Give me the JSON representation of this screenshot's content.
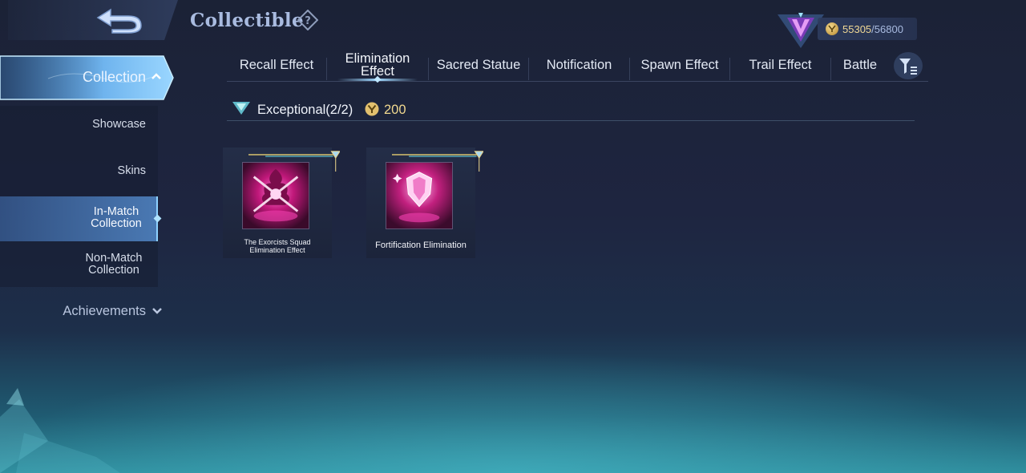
{
  "header": {
    "title": "Collectible",
    "help_icon": "question-mark-icon",
    "back_icon": "back-arrow-icon"
  },
  "currency": {
    "current": "55305",
    "max": "/56800",
    "icon": "collection-point-coin-icon",
    "rank_icon": "purple-rank-badge-icon"
  },
  "tabs": [
    {
      "label": "Recall Effect",
      "active": false
    },
    {
      "label": "Elimination Effect",
      "active": true
    },
    {
      "label": "Sacred Statue",
      "active": false
    },
    {
      "label": "Notification",
      "active": false
    },
    {
      "label": "Spawn Effect",
      "active": false
    },
    {
      "label": "Trail Effect",
      "active": false
    },
    {
      "label": "Battle",
      "active": false
    }
  ],
  "filter_icon": "filter-funnel-icon",
  "sidebar": {
    "collection_label": "Collection",
    "items": [
      {
        "label": "Showcase",
        "active": false
      },
      {
        "label": "Skins",
        "active": false
      },
      {
        "label": "In-Match Collection",
        "active": true
      },
      {
        "label": "Non-Match Collection",
        "active": false
      }
    ],
    "achievements_label": "Achievements"
  },
  "section": {
    "title": "Exceptional(2/2)",
    "cost": "200",
    "icon": "exceptional-gem-icon"
  },
  "cards": [
    {
      "name": "The Exorcists Squad Elimination Effect",
      "icon": "crossed-blades-elimination-icon"
    },
    {
      "name": "Fortification Elimination",
      "icon": "pink-crest-elimination-icon"
    }
  ],
  "colors": {
    "accent": "#8fd2ff",
    "gold": "#f1d98f",
    "title": "#a9bbe0"
  }
}
